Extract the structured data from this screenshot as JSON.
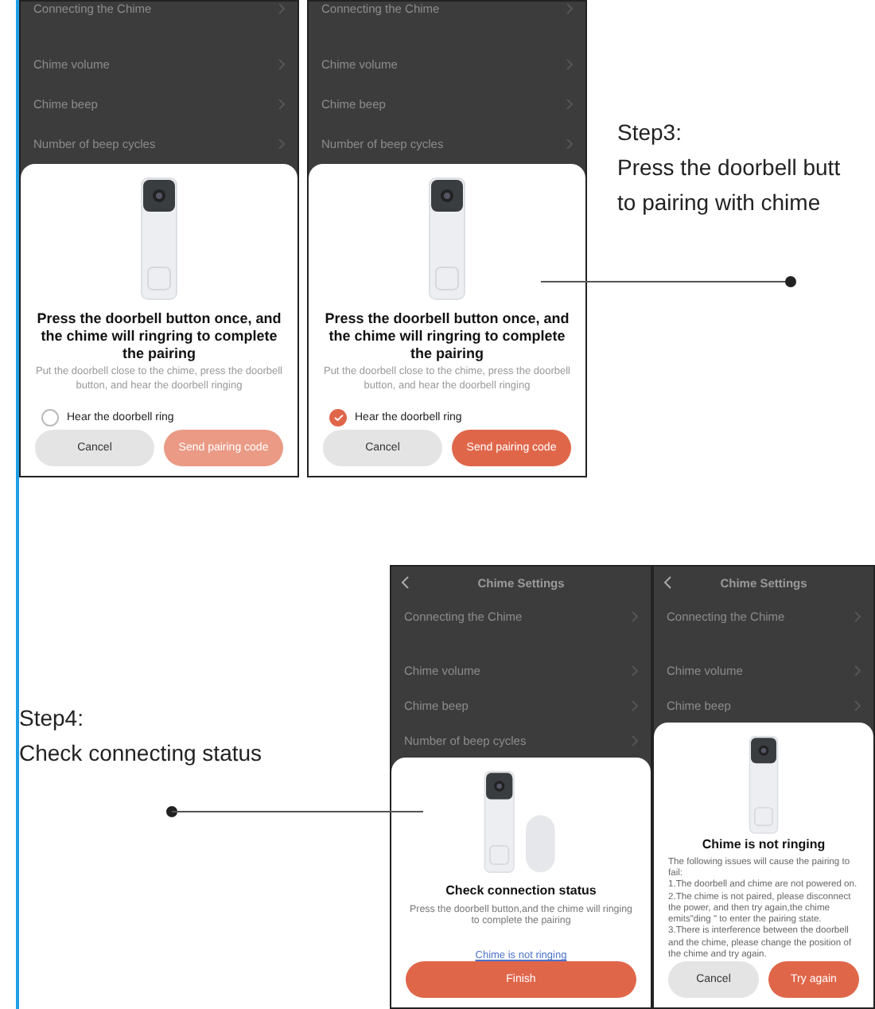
{
  "top_row": {
    "screens": [
      {
        "rows": [
          {
            "label": "Connecting the Chime"
          },
          {
            "label": "Chime volume"
          },
          {
            "label": "Chime beep"
          },
          {
            "label": "Number of beep cycles"
          }
        ],
        "sheet": {
          "kind": "pairing",
          "title": "Press the doorbell button once, and the chime will ringring to complete the pairing",
          "description": [
            "Put the doorbell close to the chime, press the doorbell button, and hear the doorbell ringing"
          ],
          "option": {
            "label": "Hear the doorbell ring",
            "checked": false
          },
          "buttons": [
            {
              "label": "Cancel",
              "kind": "secondary"
            },
            {
              "label": "Send pairing code",
              "kind": "primary",
              "disabled": true
            }
          ]
        }
      },
      {
        "rows": [
          {
            "label": "Connecting the Chime"
          },
          {
            "label": "Chime volume"
          },
          {
            "label": "Chime beep"
          },
          {
            "label": "Number of beep cycles"
          }
        ],
        "sheet": {
          "kind": "pairing",
          "title": "Press the doorbell button once, and the chime will ringring to complete the pairing",
          "description": [
            "Put the doorbell close to the chime, press the doorbell button, and hear the doorbell ringing"
          ],
          "option": {
            "label": "Hear the doorbell ring",
            "checked": true
          },
          "buttons": [
            {
              "label": "Cancel",
              "kind": "secondary"
            },
            {
              "label": "Send pairing code",
              "kind": "primary",
              "disabled": false
            }
          ]
        }
      }
    ],
    "step": {
      "lines": [
        "Step3:",
        "Press the doorbell butt",
        "to pairing with chime"
      ]
    }
  },
  "bottom_row": {
    "step": {
      "lines": [
        "Step4:",
        "Check connecting status"
      ]
    },
    "screens": [
      {
        "header": {
          "title": "Chime Settings"
        },
        "rows": [
          {
            "label": "Connecting the Chime"
          },
          {
            "label": "Chime volume"
          },
          {
            "label": "Chime beep"
          },
          {
            "label": "Number of beep cycles"
          }
        ],
        "sheet": {
          "kind": "status",
          "title": "Check connection status",
          "description": [
            "Press the doorbell button,and the chime will ringing to complete the pairing"
          ],
          "link": "Chime is not ringing",
          "buttons": [
            {
              "label": "Finish",
              "kind": "primary"
            }
          ]
        }
      },
      {
        "header": {
          "title": "Chime Settings"
        },
        "rows": [
          {
            "label": "Connecting the Chime"
          },
          {
            "label": "Chime volume"
          },
          {
            "label": "Chime beep"
          }
        ],
        "sheet": {
          "kind": "failure",
          "title": "Chime is not ringing",
          "description": [
            "The following issues will cause the pairing to fail:",
            "1.The doorbell and chime are not powered on.",
            "2.The chime is not paired, please disconnect the power, and then try again,the chime emits\"ding \" to enter the pairing state.",
            "3.There is interference between the doorbell and the chime, please change the position of the chime and try again."
          ],
          "buttons": [
            {
              "label": "Cancel",
              "kind": "secondary"
            },
            {
              "label": "Try again",
              "kind": "primary"
            }
          ]
        }
      }
    ]
  }
}
